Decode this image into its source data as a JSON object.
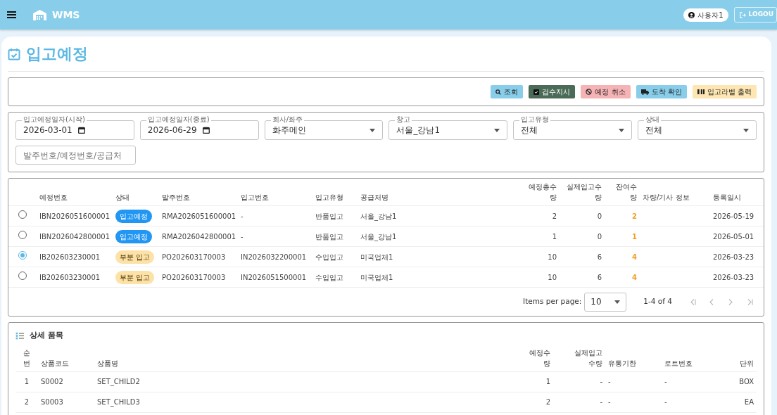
{
  "header": {
    "title": "WMS",
    "user": "사용자1",
    "logout": "LOGOU"
  },
  "page_title": "입고예정",
  "toolbar": [
    {
      "label": "조회",
      "kind": "search"
    },
    {
      "label": "검수지시",
      "kind": "inspect"
    },
    {
      "label": "예정 취소",
      "kind": "cancel"
    },
    {
      "label": "도착 확인",
      "kind": "arrive"
    },
    {
      "label": "입고라벨 출력",
      "kind": "print"
    }
  ],
  "filters": [
    {
      "label": "입고예정일자(시작)",
      "value": "2026-03-01",
      "kind": "date"
    },
    {
      "label": "입고예정일자(종료)",
      "value": "2026-06-29",
      "kind": "date"
    },
    {
      "label": "회사/화주",
      "value": "화주메인",
      "kind": "select"
    },
    {
      "label": "창고",
      "value": "서울_강남1",
      "kind": "select"
    },
    {
      "label": "입고유형",
      "value": "전체",
      "kind": "select"
    },
    {
      "label": "상태",
      "value": "전체",
      "kind": "select"
    }
  ],
  "search": {
    "placeholder": "발주번호/예정번호/공급처"
  },
  "table": {
    "columns": [
      "예정번호",
      "상태",
      "발주번호",
      "입고번호",
      "입고유형",
      "공급처명",
      "예정총수량",
      "실제입고수량",
      "잔여수량",
      "차량/기사 정보",
      "등록일시"
    ],
    "rows": [
      {
        "selected": false,
        "plan_no": "IBN2026051600001",
        "status": {
          "text": "입고예정",
          "kind": "planned"
        },
        "po_no": "RMA2026051600001",
        "receipt_no": "-",
        "type": "반품입고",
        "supplier": "서울_강남1",
        "planned_qty": "2",
        "actual_qty": "0",
        "remaining_qty": "2",
        "registered": "2026-05-19"
      },
      {
        "selected": false,
        "plan_no": "IBN2026042800001",
        "status": {
          "text": "입고예정",
          "kind": "planned"
        },
        "po_no": "RMA2026042800001",
        "receipt_no": "-",
        "type": "반품입고",
        "supplier": "서울_강남1",
        "planned_qty": "1",
        "actual_qty": "0",
        "remaining_qty": "1",
        "registered": "2026-05-01"
      },
      {
        "selected": true,
        "plan_no": "IB202603230001",
        "status": {
          "text": "부분 입고",
          "kind": "partial"
        },
        "po_no": "PO202603170003",
        "receipt_no": "IN2026032200001",
        "type": "수입입고",
        "supplier": "미국업체1",
        "planned_qty": "10",
        "actual_qty": "6",
        "remaining_qty": "4",
        "registered": "2026-03-23"
      },
      {
        "selected": false,
        "plan_no": "IB202603230001",
        "status": {
          "text": "부분 입고",
          "kind": "partial"
        },
        "po_no": "PO202603170003",
        "receipt_no": "IN2026051500001",
        "type": "수입입고",
        "supplier": "미국업체1",
        "planned_qty": "10",
        "actual_qty": "6",
        "remaining_qty": "4",
        "registered": "2026-03-23"
      }
    ]
  },
  "pagination": {
    "label": "Items per page:",
    "page_size": "10",
    "range": "1-4 of 4"
  },
  "detail": {
    "title": "상세 품목",
    "columns": [
      "순번",
      "상품코드",
      "상품명",
      "예정수량",
      "실제입고수량",
      "유통기한",
      "로트번호",
      "단위"
    ],
    "rows": [
      [
        "1",
        "S0002",
        "SET_CHILD2",
        "1",
        "-",
        "-",
        "-",
        "BOX"
      ],
      [
        "2",
        "S0003",
        "SET_CHILD3",
        "2",
        "-",
        "-",
        "-",
        "EA"
      ]
    ]
  }
}
